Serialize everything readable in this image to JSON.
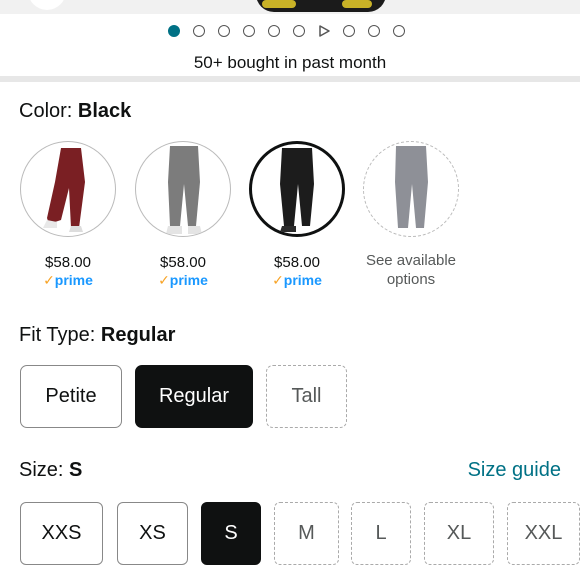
{
  "carousel": {
    "dot_count": 10,
    "active_index": 0,
    "video_index": 6
  },
  "social_proof": "50+ bought in past month",
  "color": {
    "label": "Color: ",
    "selected": "Black",
    "swatches": [
      {
        "name": "maroon",
        "price": "$58.00",
        "prime_check": "✓",
        "prime": "prime",
        "pant_color": "#7a1f23",
        "selected": false
      },
      {
        "name": "gray",
        "price": "$58.00",
        "prime_check": "✓",
        "prime": "prime",
        "pant_color": "#7c7c7c",
        "selected": false
      },
      {
        "name": "black",
        "price": "$58.00",
        "prime_check": "✓",
        "prime": "prime",
        "pant_color": "#1c1c1c",
        "selected": true
      },
      {
        "name": "light-gray",
        "see_line1": "See available",
        "see_line2": "options",
        "pant_color": "#8e9097",
        "selected": false
      }
    ]
  },
  "fit": {
    "label": "Fit Type: ",
    "selected": "Regular",
    "options": [
      {
        "label": "Petite",
        "state": "normal"
      },
      {
        "label": "Regular",
        "state": "selected"
      },
      {
        "label": "Tall",
        "state": "unavailable"
      }
    ]
  },
  "size": {
    "label": "Size: ",
    "selected": "S",
    "guide_label": "Size guide",
    "options": [
      {
        "label": "XXS",
        "state": "normal"
      },
      {
        "label": "XS",
        "state": "normal"
      },
      {
        "label": "S",
        "state": "selected"
      },
      {
        "label": "M",
        "state": "unavailable"
      },
      {
        "label": "L",
        "state": "unavailable"
      },
      {
        "label": "XL",
        "state": "unavailable"
      },
      {
        "label": "XXL",
        "state": "unavailable"
      }
    ]
  },
  "colors": {
    "link": "#007185",
    "prime_blue": "#1a98ff",
    "prime_check": "#f7a325",
    "selected_bg": "#0f1111",
    "active_dot": "#007185"
  }
}
